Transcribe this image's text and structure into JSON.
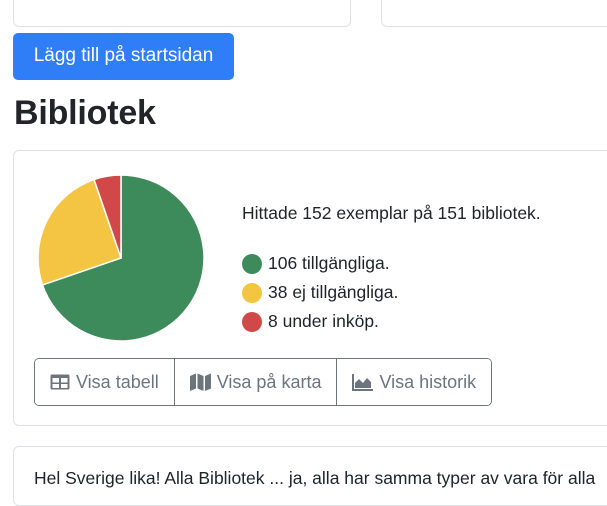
{
  "actions": {
    "add_to_start_label": "Lägg till på startsidan"
  },
  "library": {
    "title": "Bibliotek",
    "summary": "Hittade 152 exemplar på 151 bibliotek.",
    "legend": [
      {
        "label": "106 tillgängliga.",
        "color": "#3d8a5a"
      },
      {
        "label": "38 ej tillgängliga.",
        "color": "#f4c542"
      },
      {
        "label": "8 under inköp.",
        "color": "#d04848"
      }
    ],
    "chart_data": {
      "type": "pie",
      "values": [
        106,
        38,
        8
      ],
      "colors": [
        "#3d8a5a",
        "#f4c542",
        "#d04848"
      ]
    },
    "view_buttons": [
      {
        "label": "Visa tabell",
        "icon": "table-icon"
      },
      {
        "label": "Visa på karta",
        "icon": "map-icon"
      },
      {
        "label": "Visa historik",
        "icon": "area-chart-icon"
      }
    ]
  },
  "next_card": {
    "text": "Hel Sverige lika! Alla Bibliotek ... ja, alla har samma typer av vara för alla"
  }
}
